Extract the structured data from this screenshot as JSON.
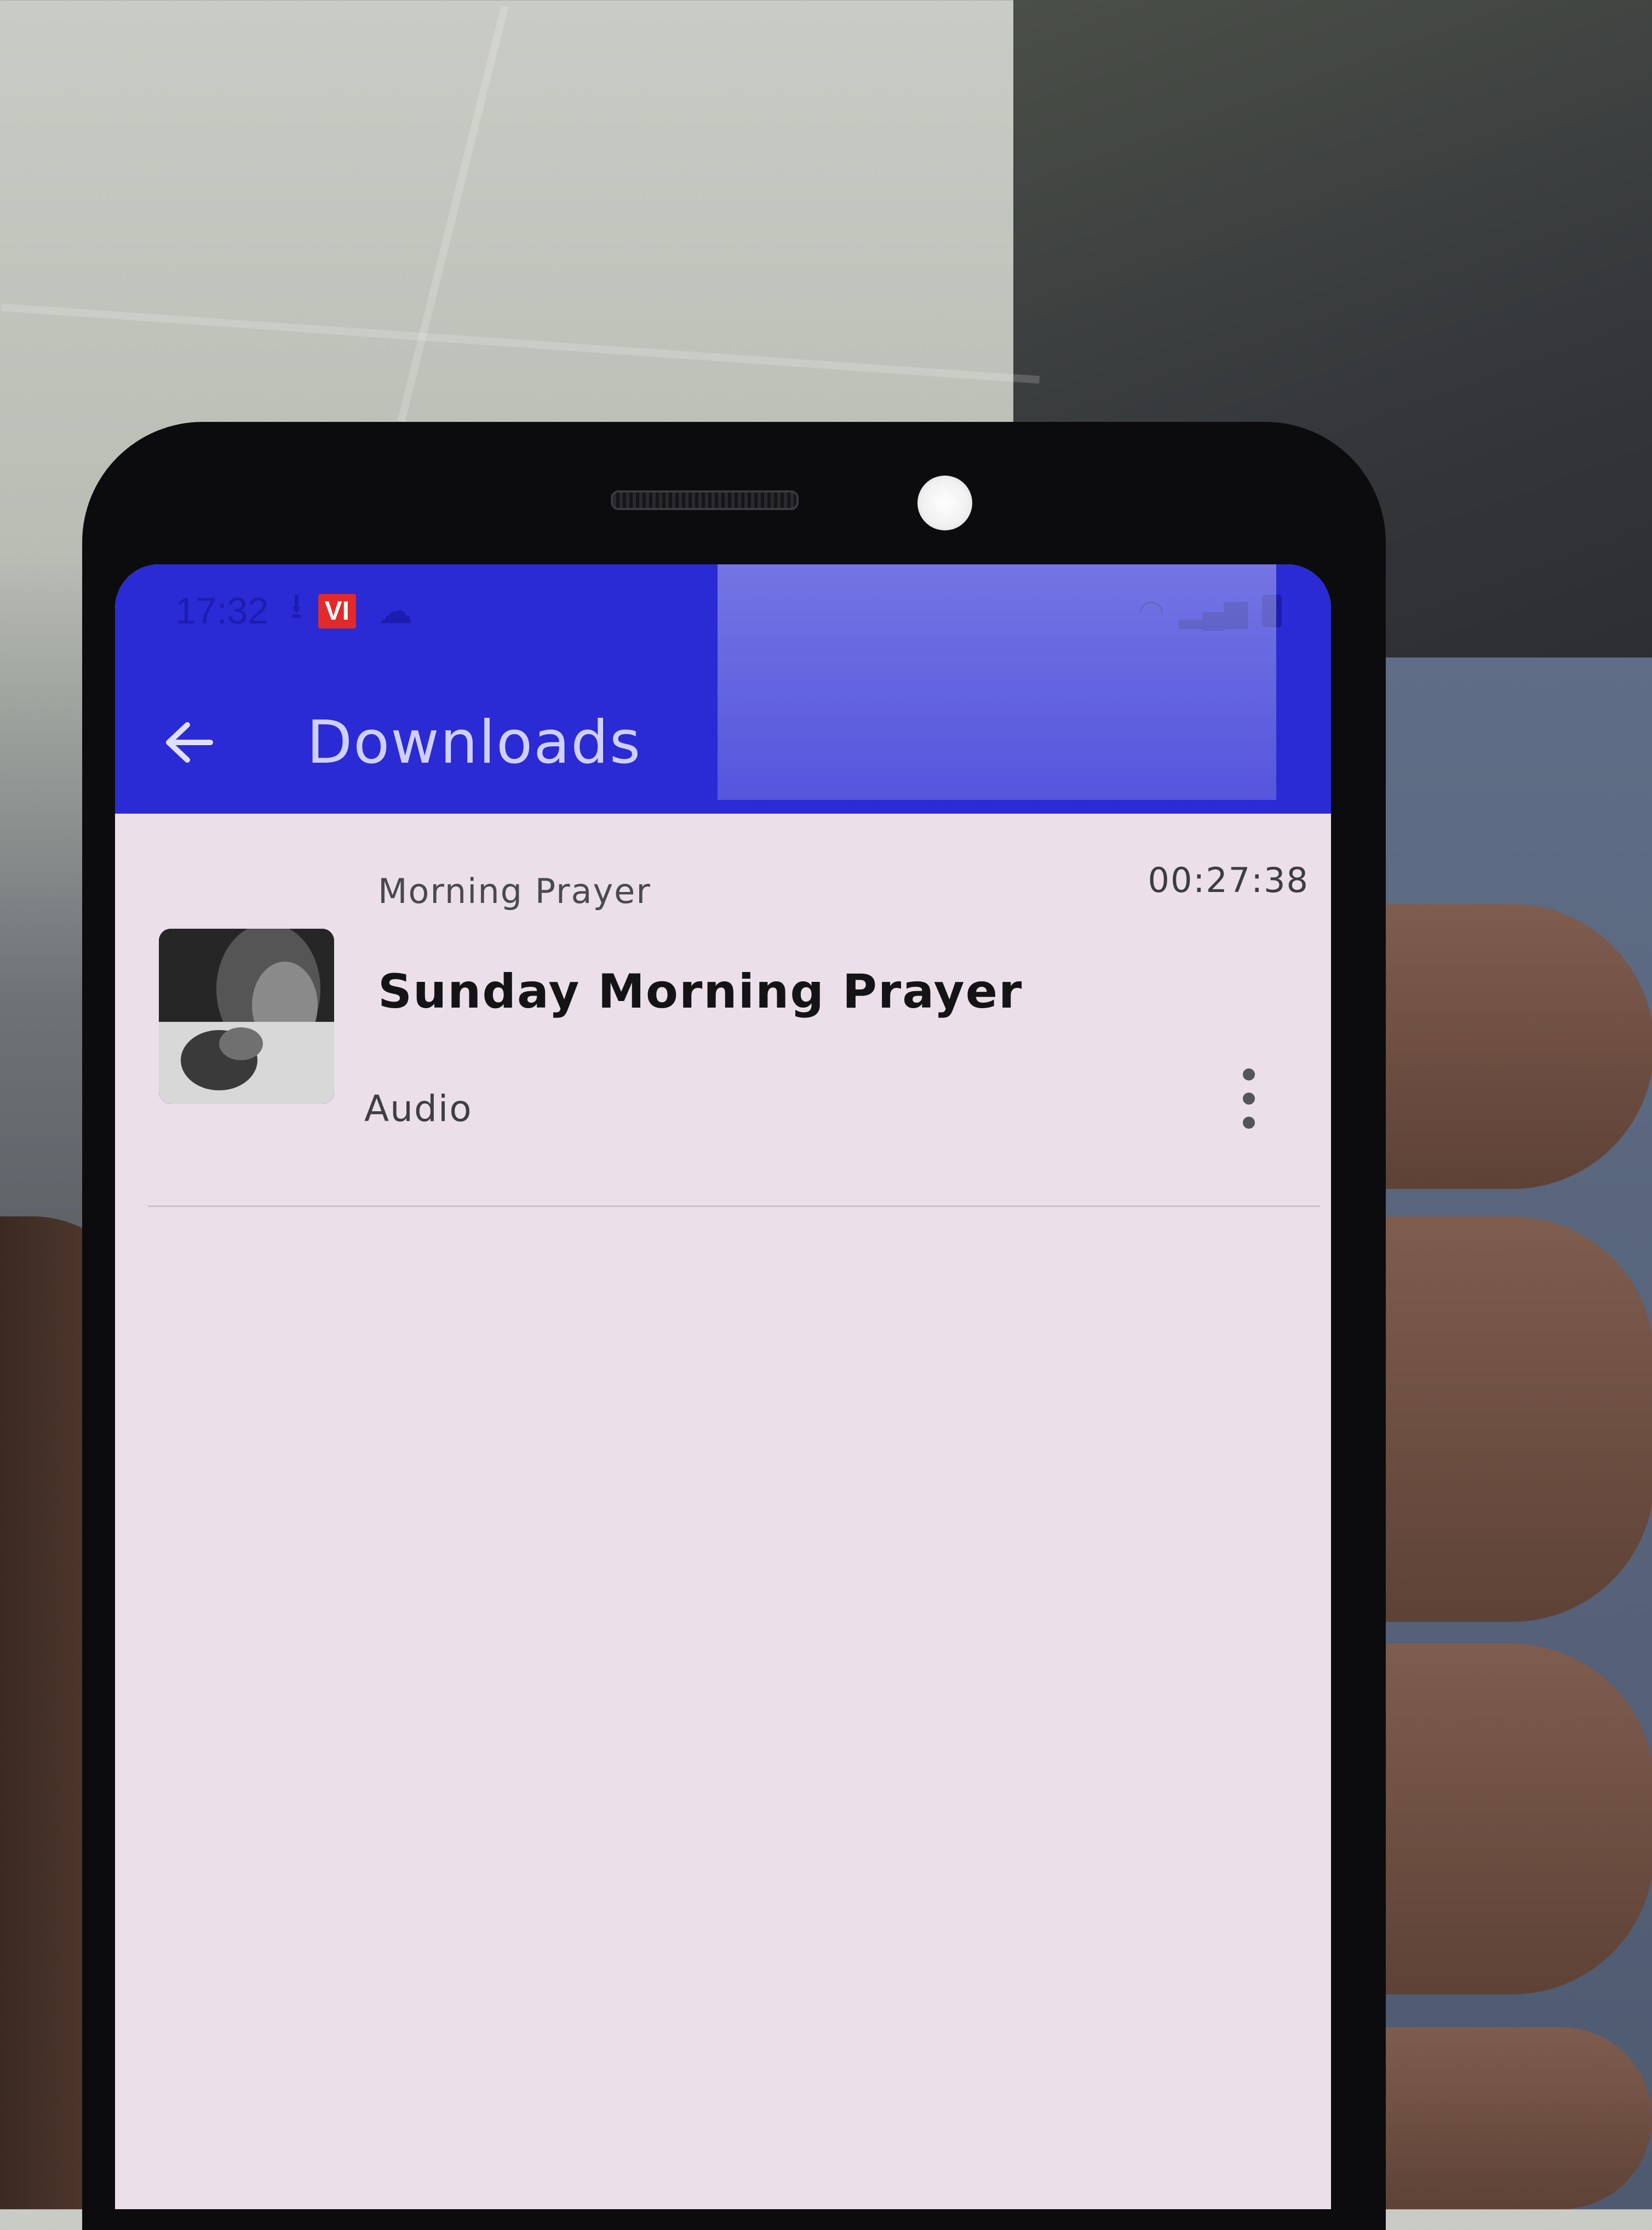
{
  "status_bar": {
    "time": "17:32",
    "carrier_badge": "VI",
    "icons": [
      "download-icon",
      "cloud-icon",
      "wifi-icon",
      "signal-icon",
      "battery-icon"
    ]
  },
  "app_bar": {
    "title": "Downloads",
    "back_icon": "arrow-left-icon",
    "color": "#2a2bd4"
  },
  "downloads": {
    "items": [
      {
        "category": "Morning Prayer",
        "title": "Sunday Morning Prayer",
        "type": "Audio",
        "duration": "00:27:38",
        "more_icon": "more-vertical-icon"
      }
    ]
  }
}
